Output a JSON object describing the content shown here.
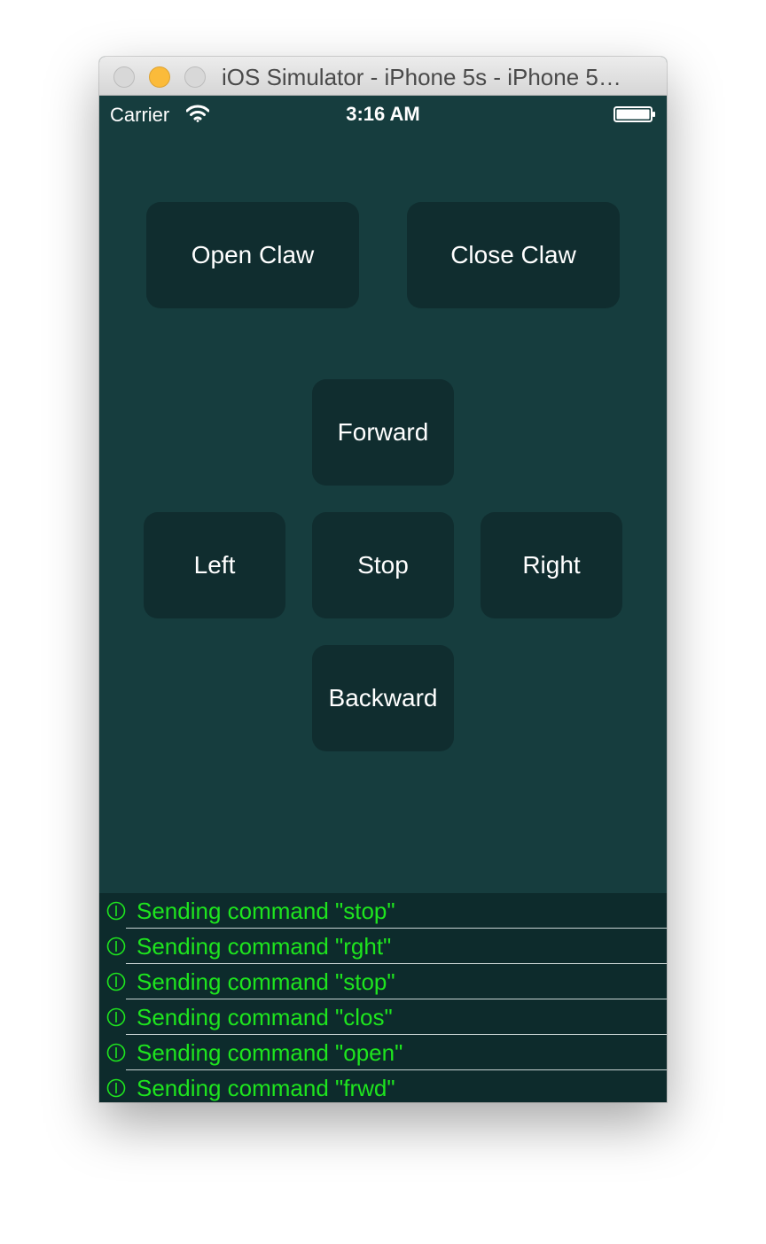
{
  "window": {
    "title": "iOS Simulator - iPhone 5s - iPhone 5…"
  },
  "status_bar": {
    "carrier": "Carrier",
    "time": "3:16 AM",
    "signal_icon": "wifi-icon",
    "battery_icon": "battery-icon"
  },
  "controls": {
    "open_claw": "Open Claw",
    "close_claw": "Close Claw",
    "forward": "Forward",
    "left": "Left",
    "stop": "Stop",
    "right": "Right",
    "backward": "Backward"
  },
  "log": {
    "icon": "info-icon",
    "entries": [
      "Sending command \"stop\"",
      "Sending command \"rght\"",
      "Sending command \"stop\"",
      "Sending command \"clos\"",
      "Sending command \"open\"",
      "Sending command \"frwd\""
    ]
  },
  "colors": {
    "background": "#163d3e",
    "button": "#102d2f",
    "log_background": "#0d2b2c",
    "log_text": "#1ee51e",
    "minimize_light": "#fbbb3a"
  }
}
